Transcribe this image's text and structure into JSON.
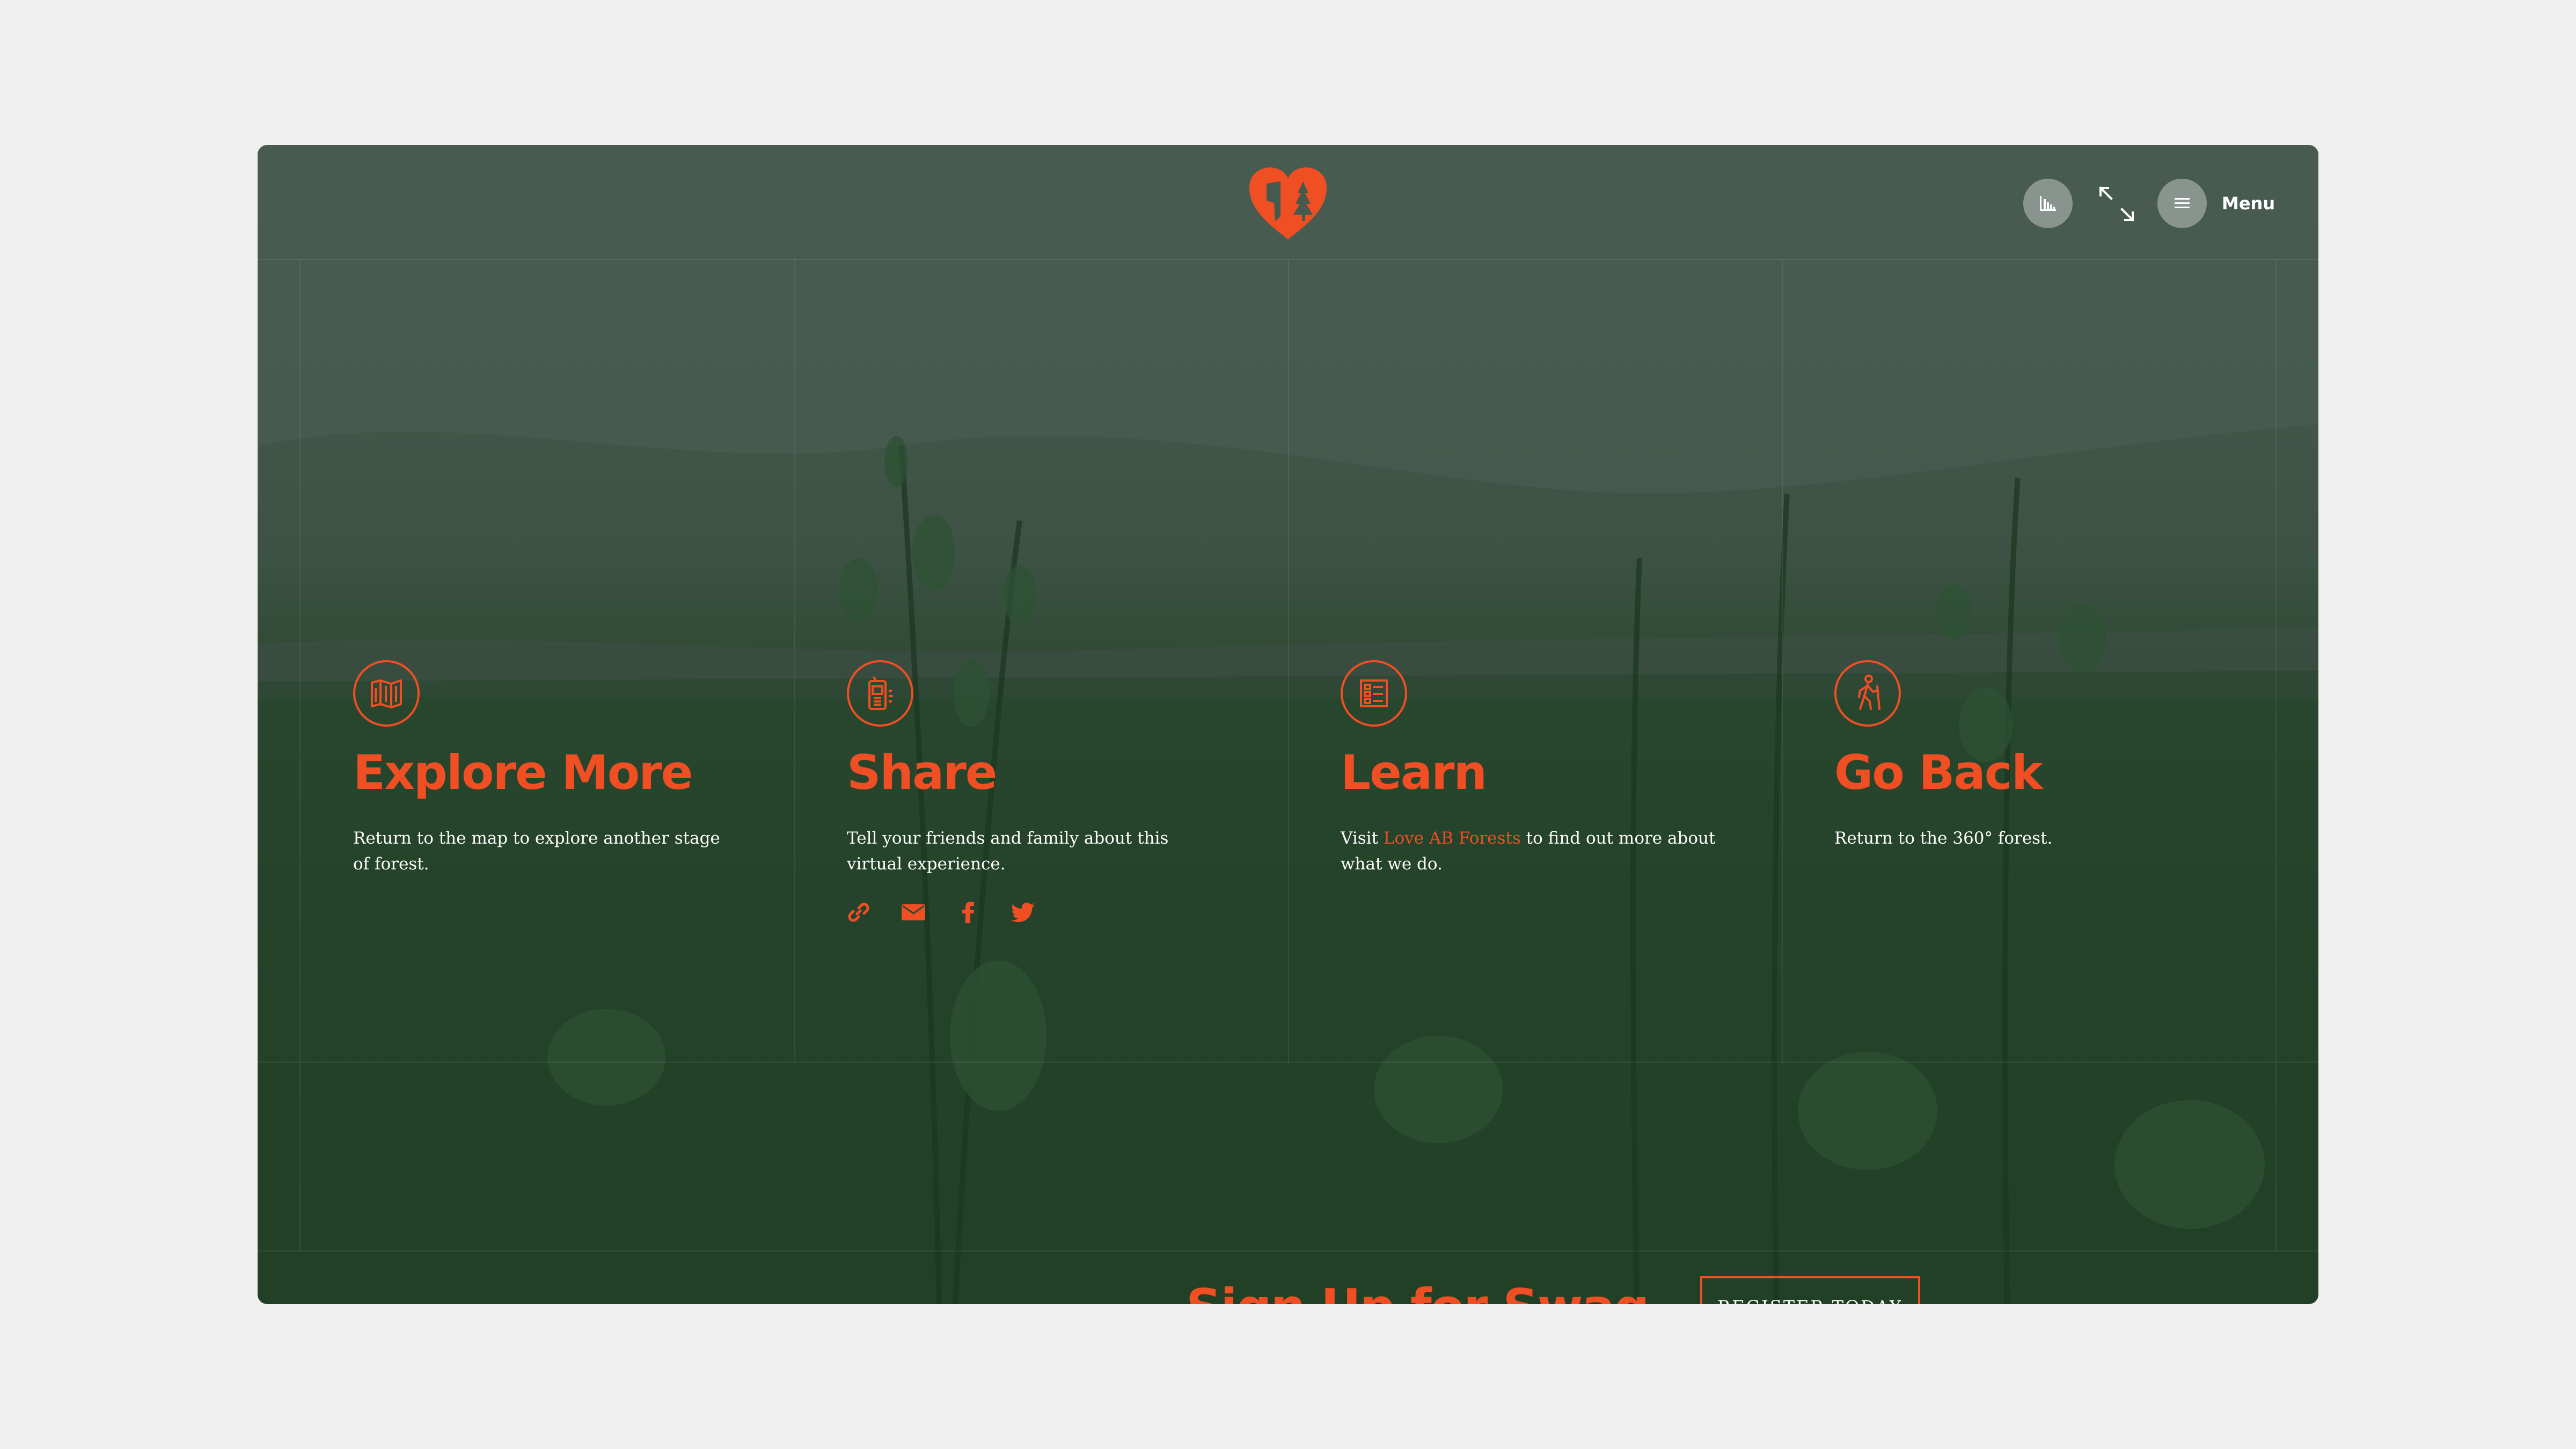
{
  "header": {
    "logo_icon": "heart-forest-logo-icon",
    "stats_icon": "bar-chart-icon",
    "expand_icon": "expand-icon",
    "menu_icon": "hamburger-icon",
    "menu_label": "Menu"
  },
  "columns": [
    {
      "icon": "map-icon",
      "title": "Explore More",
      "text": "Return to the map to explore another stage of forest."
    },
    {
      "icon": "phone-share-icon",
      "title": "Share",
      "text": "Tell your friends and family about this virtual experience.",
      "share_icons": [
        "link-icon",
        "email-icon",
        "facebook-icon",
        "twitter-icon"
      ]
    },
    {
      "icon": "news-list-icon",
      "title": "Learn",
      "text_before": "Visit ",
      "link": "Love AB Forests",
      "text_after": " to find out more about what we do."
    },
    {
      "icon": "hiker-icon",
      "title": "Go Back",
      "text": "Return to the 360° forest."
    }
  ],
  "signup": {
    "title": "Sign Up for Swag",
    "button_label": "REGISTER TODAY"
  },
  "colors": {
    "accent": "#f04e23",
    "page_background": "#efefef",
    "overlay": "#2f4a34"
  }
}
